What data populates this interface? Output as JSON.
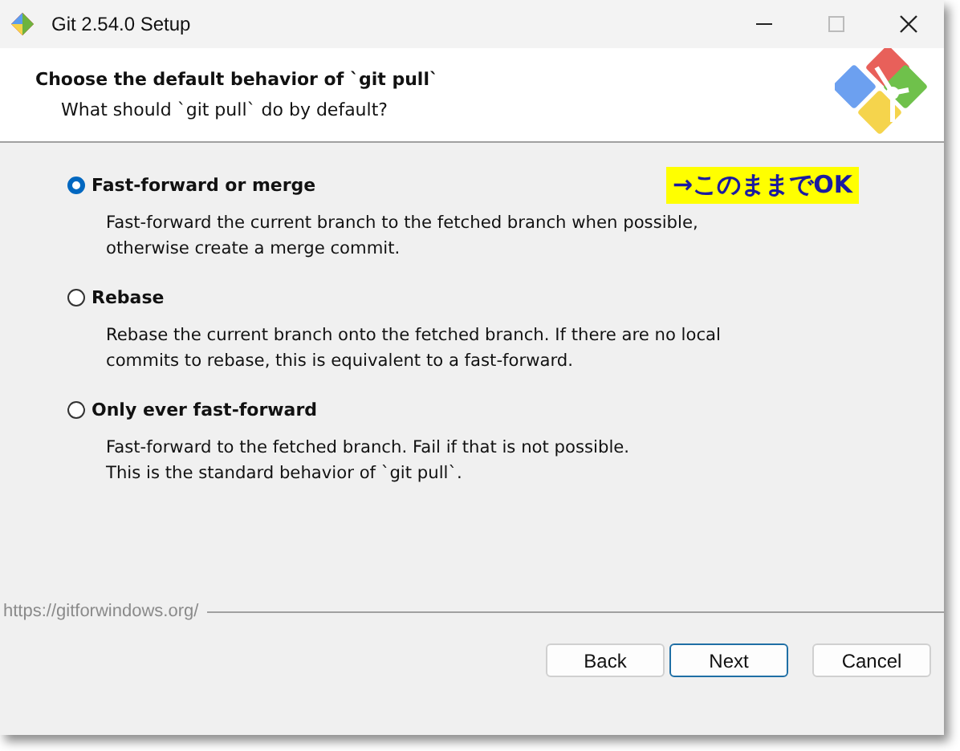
{
  "window": {
    "title": "Git 2.54.0 Setup"
  },
  "header": {
    "title": "Choose the default behavior of `git pull`",
    "subtitle": "What should `git pull` do by default?"
  },
  "options": [
    {
      "label": "Fast-forward or merge",
      "selected": true,
      "description": "Fast-forward the current branch to the fetched branch when possible, otherwise create a merge commit."
    },
    {
      "label": "Rebase",
      "selected": false,
      "description": "Rebase the current branch onto the fetched branch. If there are no local commits to rebase, this is equivalent to a fast-forward."
    },
    {
      "label": "Only ever fast-forward",
      "selected": false,
      "description": "Fast-forward to the fetched branch. Fail if that is not possible.\nThis is the standard behavior of `git pull`."
    }
  ],
  "annotation": {
    "text": "→このままでOK"
  },
  "footer": {
    "url": "https://gitforwindows.org/"
  },
  "buttons": [
    {
      "label": "Back",
      "default": false
    },
    {
      "label": "Next",
      "default": true
    },
    {
      "label": "Cancel",
      "default": false
    }
  ]
}
